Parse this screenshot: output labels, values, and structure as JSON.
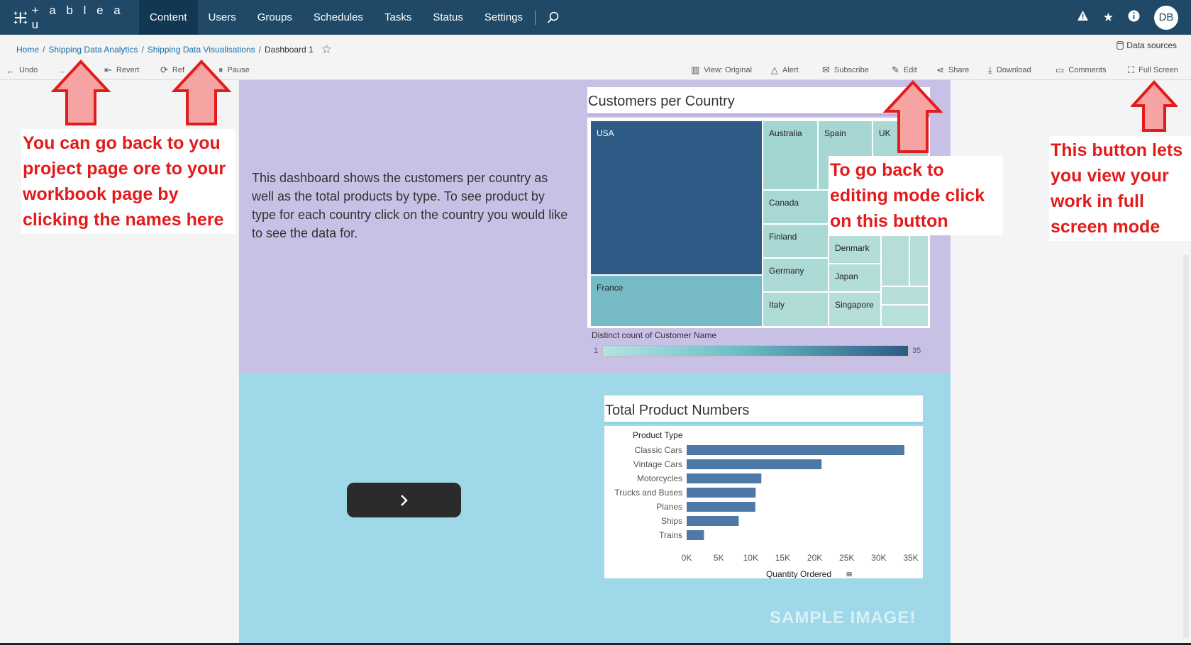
{
  "nav": {
    "brand": "+ a b l e a u",
    "tabs": [
      "Content",
      "Users",
      "Groups",
      "Schedules",
      "Tasks",
      "Status",
      "Settings"
    ],
    "avatar": "DB"
  },
  "breadcrumb": {
    "home": "Home",
    "project": "Shipping Data Analytics",
    "workbook": "Shipping Data Visualisations",
    "current": "Dashboard 1",
    "separator": "/"
  },
  "data_sources": "Data sources",
  "toolbar": {
    "undo": "Undo",
    "revert": "Revert",
    "refresh": "Ref",
    "pause": "Pause",
    "view": "View: Original",
    "alert": "Alert",
    "subscribe": "Subscribe",
    "edit": "Edit",
    "share": "Share",
    "download": "Download",
    "comments": "Comments",
    "full_screen": "Full Screen"
  },
  "dashboard": {
    "intro": "This dashboard shows the customers per country as well as the total products by type.  To see product by type for each country click on the country you would like to see the data for.",
    "treemap": {
      "title": "Customers per Country",
      "cells": [
        "USA",
        "France",
        "Australia",
        "Spain",
        "UK",
        "Canada",
        "Finland",
        "Germany",
        "Italy",
        "Denmark",
        "Japan",
        "Singapore"
      ],
      "legend_label": "Distinct count of Customer Name",
      "legend_min": "1",
      "legend_max": "35"
    },
    "bar_chart_title": "Total Product Numbers",
    "watermark": "SAMPLE IMAGE!"
  },
  "chart_data": {
    "type": "bar",
    "orientation": "horizontal",
    "title": "Total Product Numbers",
    "categories_header": "Product Type",
    "categories": [
      "Classic Cars",
      "Vintage Cars",
      "Motorcycles",
      "Trucks and Buses",
      "Planes",
      "Ships",
      "Trains"
    ],
    "values": [
      33992,
      21069,
      11663,
      10777,
      10727,
      8127,
      2712
    ],
    "xlabel": "Quantity Ordered",
    "xticks": [
      "0K",
      "5K",
      "10K",
      "15K",
      "20K",
      "25K",
      "30K",
      "35K"
    ],
    "xlim": [
      0,
      35000
    ],
    "color": "#4e79a7"
  },
  "annotations": {
    "breadcrumb_note": "You can go back to you project page ore to your workbook page by clicking the names here",
    "edit_note": "To go back to editing mode click on this button",
    "fullscreen_note": "This button lets you view your work in full screen mode"
  }
}
